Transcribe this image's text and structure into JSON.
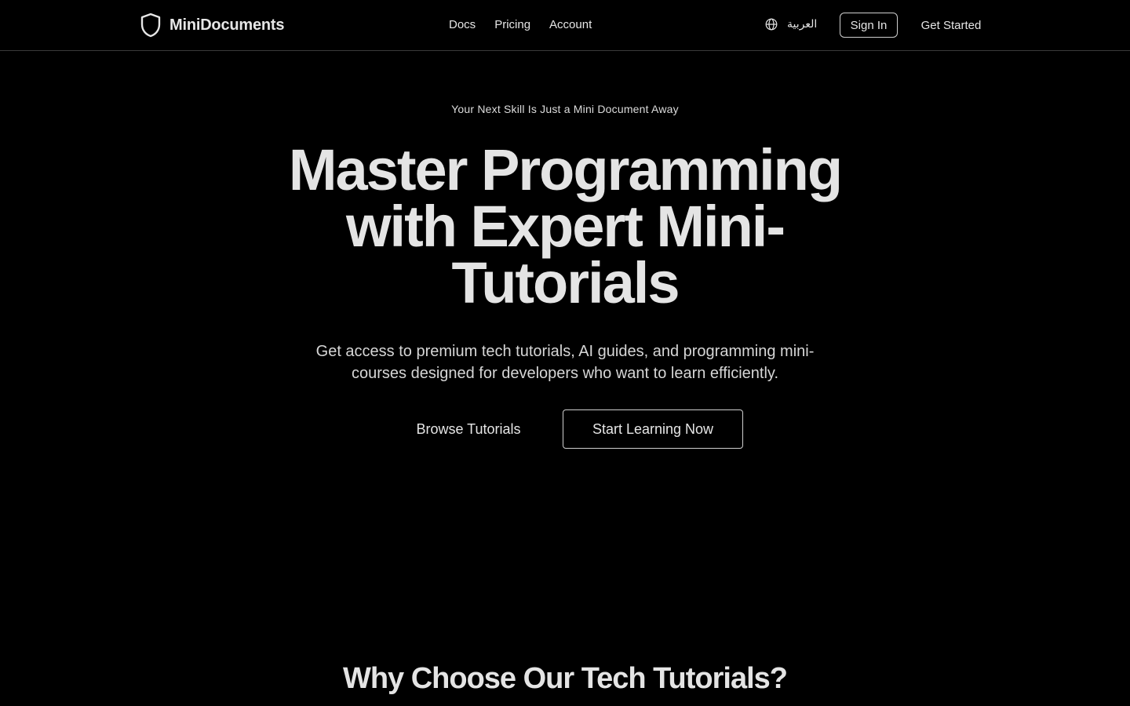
{
  "brand": {
    "name": "MiniDocuments",
    "icon": "shield-icon"
  },
  "nav": {
    "links": [
      {
        "label": "Docs"
      },
      {
        "label": "Pricing"
      },
      {
        "label": "Account"
      }
    ]
  },
  "header_actions": {
    "language_icon": "globe-icon",
    "language_label": "العربية",
    "signin_label": "Sign In",
    "get_started_label": "Get Started"
  },
  "hero": {
    "eyebrow": "Your Next Skill Is Just a Mini Document Away",
    "headline": "Master Programming with Expert Mini-Tutorials",
    "subtext": "Get access to premium tech tutorials, AI guides, and programming mini-courses designed for developers who want to learn efficiently.",
    "browse_label": "Browse Tutorials",
    "start_label": "Start Learning Now"
  },
  "features": {
    "title": "Why Choose Our Tech Tutorials?"
  },
  "colors": {
    "background": "#000000",
    "text": "#e6e6e6",
    "border": "#cfcfcf",
    "divider": "#3a3a3a"
  }
}
